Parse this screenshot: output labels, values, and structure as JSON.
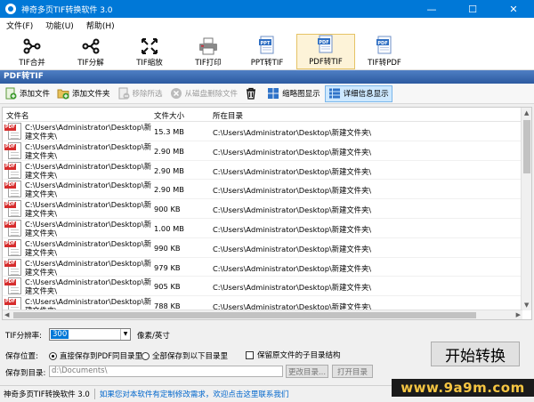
{
  "window": {
    "title": "神奇多页TIF转换软件 3.0",
    "controls": [
      "—",
      "☐",
      "✕"
    ]
  },
  "menu": [
    "文件(F)",
    "功能(U)",
    "帮助(H)"
  ],
  "toolbar": {
    "tools": [
      {
        "label": "TIF合并",
        "icon": "merge-icon"
      },
      {
        "label": "TIF分解",
        "icon": "split-icon"
      },
      {
        "label": "TIF缩放",
        "icon": "resize-icon"
      },
      {
        "label": "TIF打印",
        "icon": "printer-icon"
      },
      {
        "label": "PPT转TIF",
        "icon": "ppt-icon",
        "badge": "PPT"
      },
      {
        "label": "PDF转TIF",
        "icon": "pdf-icon",
        "badge": "PDF",
        "active": true
      },
      {
        "label": "TIF转PDF",
        "icon": "pdf-icon",
        "badge": "PDF"
      }
    ]
  },
  "section_title": "PDF转TIF",
  "actions": {
    "add_file": "添加文件",
    "add_folder": "添加文件夹",
    "remove_selected": "移除所选",
    "delete_from_disk": "从磁盘删除文件",
    "thumbnail_view": "缩略图显示",
    "detail_view": "详细信息显示"
  },
  "grid": {
    "columns": [
      "文件名",
      "文件大小",
      "所在目录"
    ],
    "rows": [
      {
        "name": "C:\\Users\\Administrator\\Desktop\\新建文件夹\\",
        "size": "15.3 MB",
        "dir": "C:\\Users\\Administrator\\Desktop\\新建文件夹\\"
      },
      {
        "name": "C:\\Users\\Administrator\\Desktop\\新建文件夹\\",
        "size": "2.90 MB",
        "dir": "C:\\Users\\Administrator\\Desktop\\新建文件夹\\"
      },
      {
        "name": "C:\\Users\\Administrator\\Desktop\\新建文件夹\\",
        "size": "2.90 MB",
        "dir": "C:\\Users\\Administrator\\Desktop\\新建文件夹\\"
      },
      {
        "name": "C:\\Users\\Administrator\\Desktop\\新建文件夹\\",
        "size": "2.90 MB",
        "dir": "C:\\Users\\Administrator\\Desktop\\新建文件夹\\"
      },
      {
        "name": "C:\\Users\\Administrator\\Desktop\\新建文件夹\\",
        "size": "900 KB",
        "dir": "C:\\Users\\Administrator\\Desktop\\新建文件夹\\"
      },
      {
        "name": "C:\\Users\\Administrator\\Desktop\\新建文件夹\\",
        "size": "1.00 MB",
        "dir": "C:\\Users\\Administrator\\Desktop\\新建文件夹\\"
      },
      {
        "name": "C:\\Users\\Administrator\\Desktop\\新建文件夹\\",
        "size": "990 KB",
        "dir": "C:\\Users\\Administrator\\Desktop\\新建文件夹\\"
      },
      {
        "name": "C:\\Users\\Administrator\\Desktop\\新建文件夹\\",
        "size": "979 KB",
        "dir": "C:\\Users\\Administrator\\Desktop\\新建文件夹\\"
      },
      {
        "name": "C:\\Users\\Administrator\\Desktop\\新建文件夹\\",
        "size": "905 KB",
        "dir": "C:\\Users\\Administrator\\Desktop\\新建文件夹\\"
      },
      {
        "name": "C:\\Users\\Administrator\\Desktop\\新建文件夹\\",
        "size": "788 KB",
        "dir": "C:\\Users\\Administrator\\Desktop\\新建文件夹\\"
      }
    ],
    "file_badge": "PDF"
  },
  "settings": {
    "dpi_label": "TIF分辨率:",
    "dpi_value": "300",
    "dpi_unit": "像素/英寸",
    "save_label": "保存位置:",
    "save_same": "直接保存到PDF同目录里",
    "save_other": "全部保存到以下目录里",
    "keep_structure": "保留原文件的子目录结构",
    "save_dir_label": "保存到目录:",
    "save_dir_value": "d:\\Documents\\",
    "change_dir": "更改目录...",
    "open_dir": "打开目录",
    "start": "开始转换"
  },
  "status": {
    "app": "神奇多页TIF转换软件 3.0",
    "message": "如果您对本软件有定制修改需求，欢迎点击这里联系我们"
  },
  "watermark": "www.9a9m.com"
}
